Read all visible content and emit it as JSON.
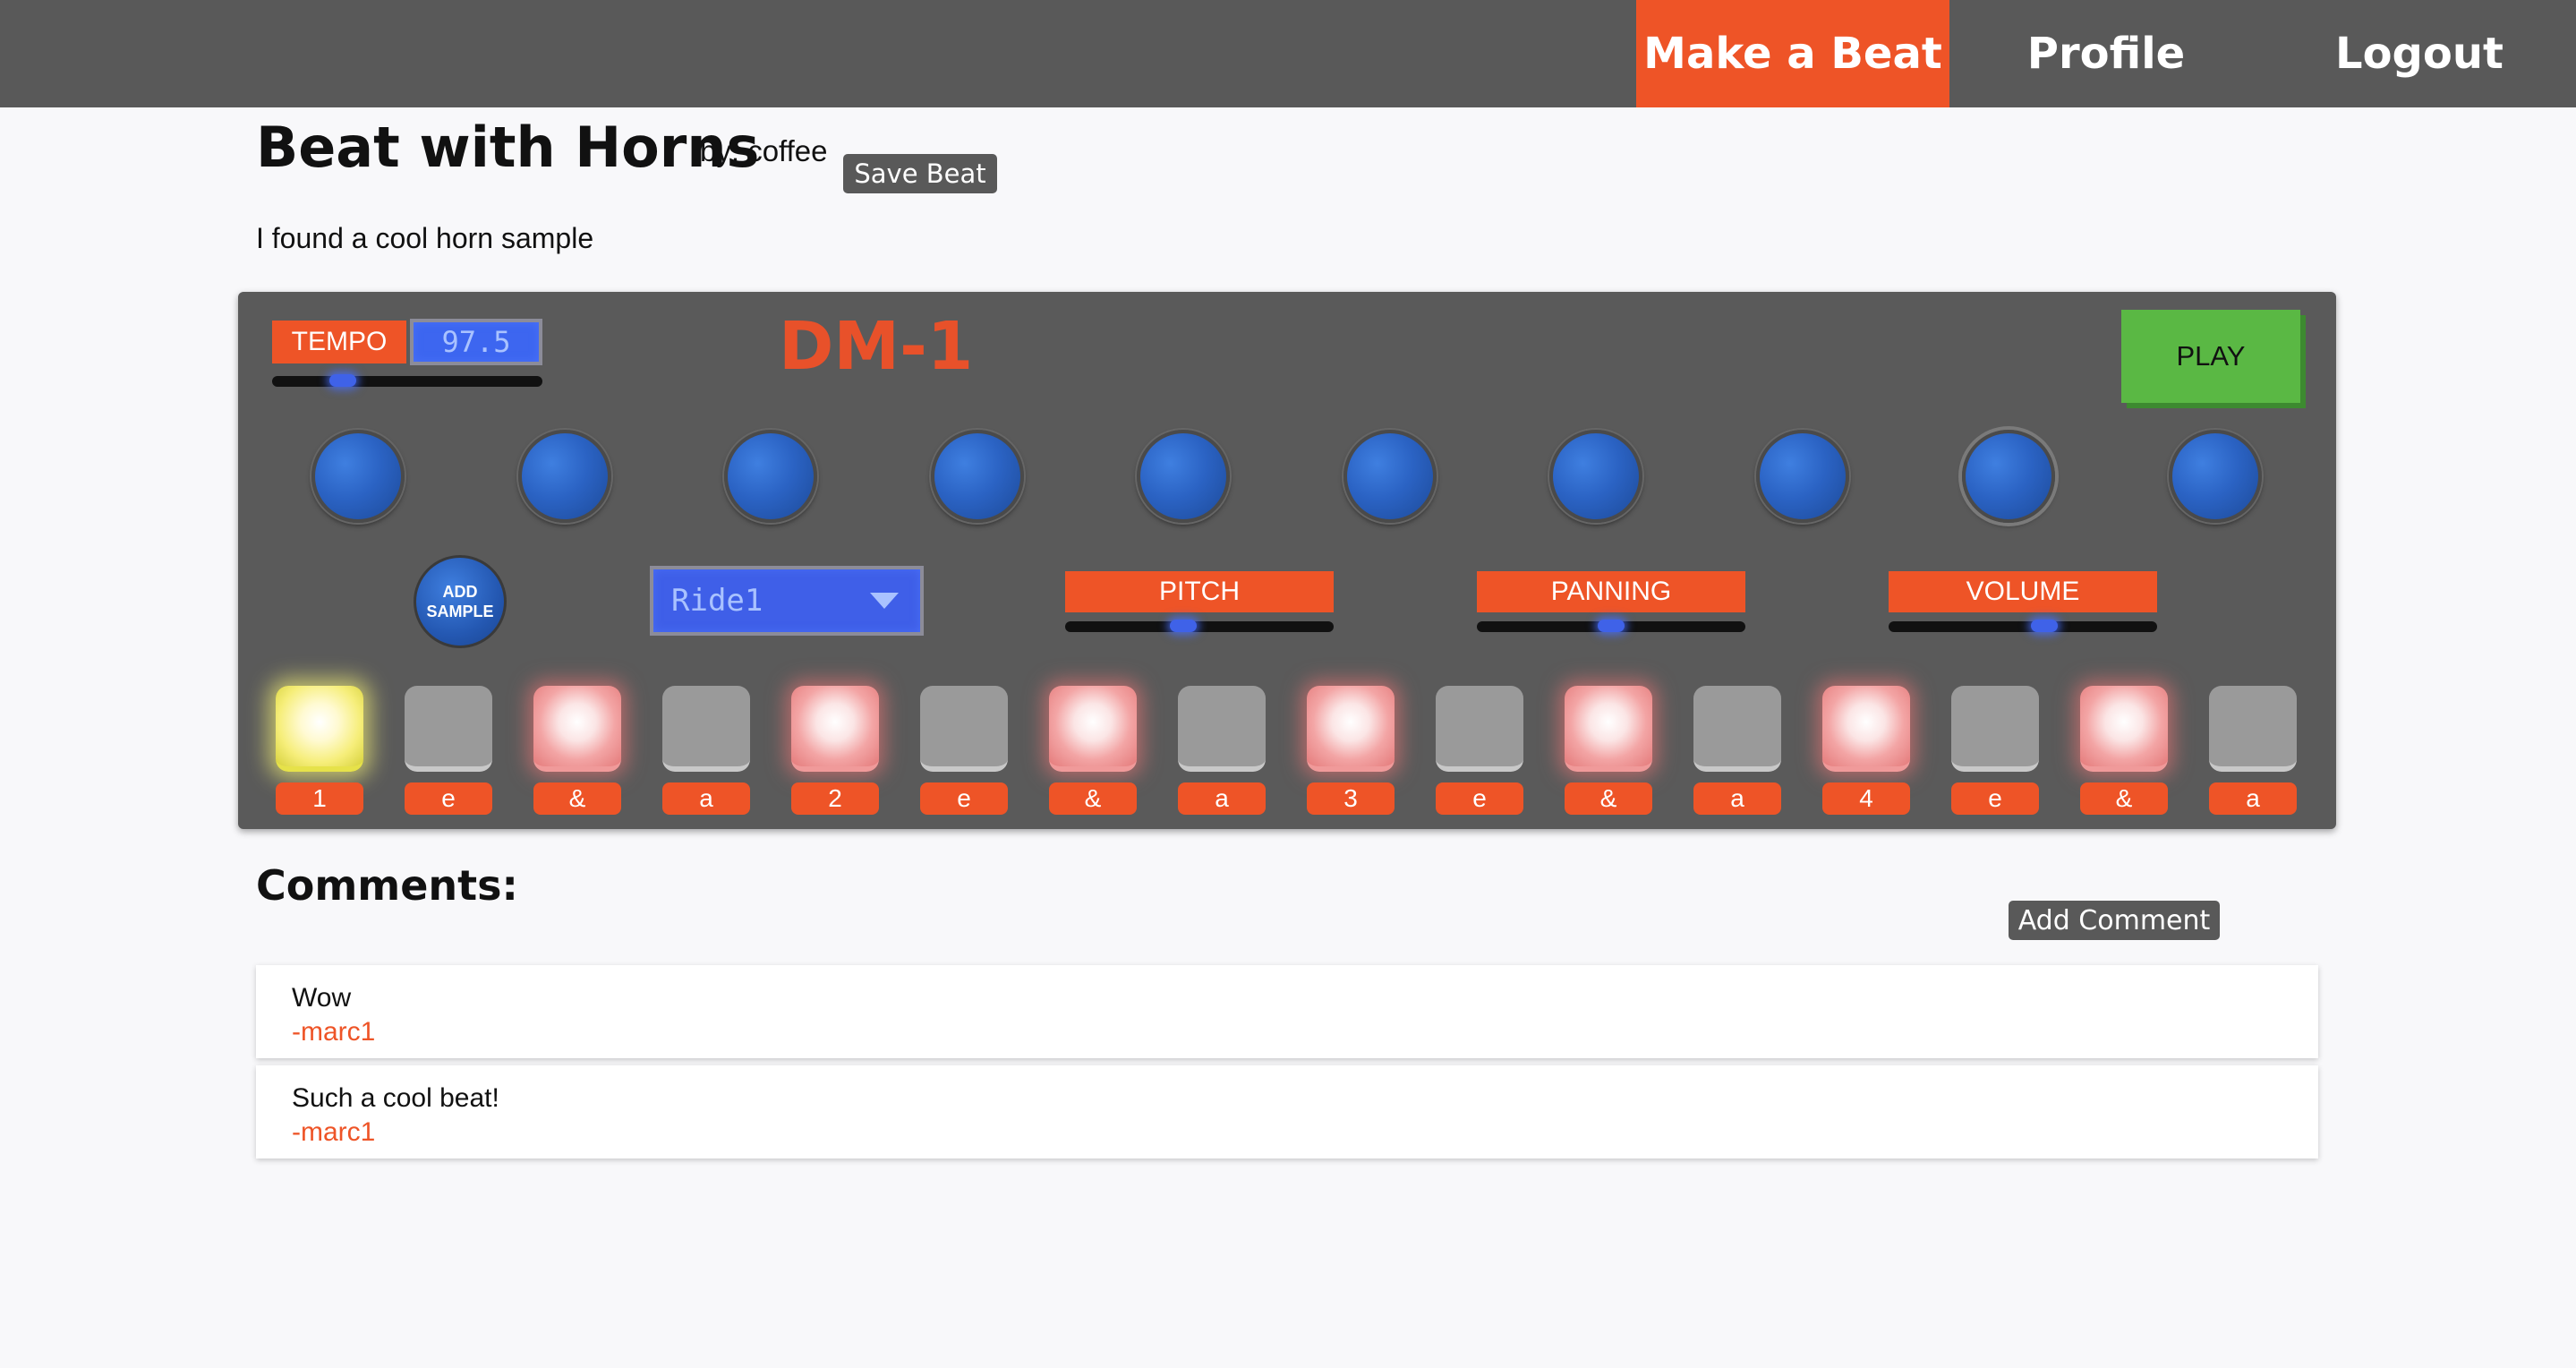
{
  "nav": {
    "make_beat": "Make a Beat",
    "profile": "Profile",
    "logout": "Logout"
  },
  "beat": {
    "title": "Beat with Horns",
    "author": "by: coffee",
    "save_label": "Save Beat",
    "description": "I found a cool horn sample"
  },
  "machine": {
    "name": "DM-1",
    "tempo_label": "TEMPO",
    "tempo_value": "97.5",
    "tempo_slider_fraction": 0.26,
    "play_label": "PLAY",
    "knob_count": 10,
    "active_knob_index": 8,
    "add_sample_line1": "ADD",
    "add_sample_line2": "SAMPLE",
    "selected_sample": "Ride1",
    "params": [
      {
        "label": "PITCH",
        "slider_fraction": 0.44
      },
      {
        "label": "PANNING",
        "slider_fraction": 0.5
      },
      {
        "label": "VOLUME",
        "slider_fraction": 0.58
      }
    ],
    "steps": [
      {
        "label": "1",
        "state": "current"
      },
      {
        "label": "e",
        "state": "off"
      },
      {
        "label": "&",
        "state": "on"
      },
      {
        "label": "a",
        "state": "off"
      },
      {
        "label": "2",
        "state": "on"
      },
      {
        "label": "e",
        "state": "off"
      },
      {
        "label": "&",
        "state": "on"
      },
      {
        "label": "a",
        "state": "off"
      },
      {
        "label": "3",
        "state": "on"
      },
      {
        "label": "e",
        "state": "off"
      },
      {
        "label": "&",
        "state": "on"
      },
      {
        "label": "a",
        "state": "off"
      },
      {
        "label": "4",
        "state": "on"
      },
      {
        "label": "e",
        "state": "off"
      },
      {
        "label": "&",
        "state": "on"
      },
      {
        "label": "a",
        "state": "off"
      }
    ],
    "colors": {
      "accent": "#ee5427",
      "display_blue": "#3d66f0",
      "play_green": "#5ab844",
      "pad_on": "#f3a5a5",
      "pad_current": "#f6ee7a",
      "pad_off": "#9a9a9a"
    }
  },
  "comments": {
    "title": "Comments:",
    "add_label": "Add Comment",
    "items": [
      {
        "text": "Wow",
        "author": "-marc1"
      },
      {
        "text": "Such a cool beat!",
        "author": "-marc1"
      }
    ]
  }
}
